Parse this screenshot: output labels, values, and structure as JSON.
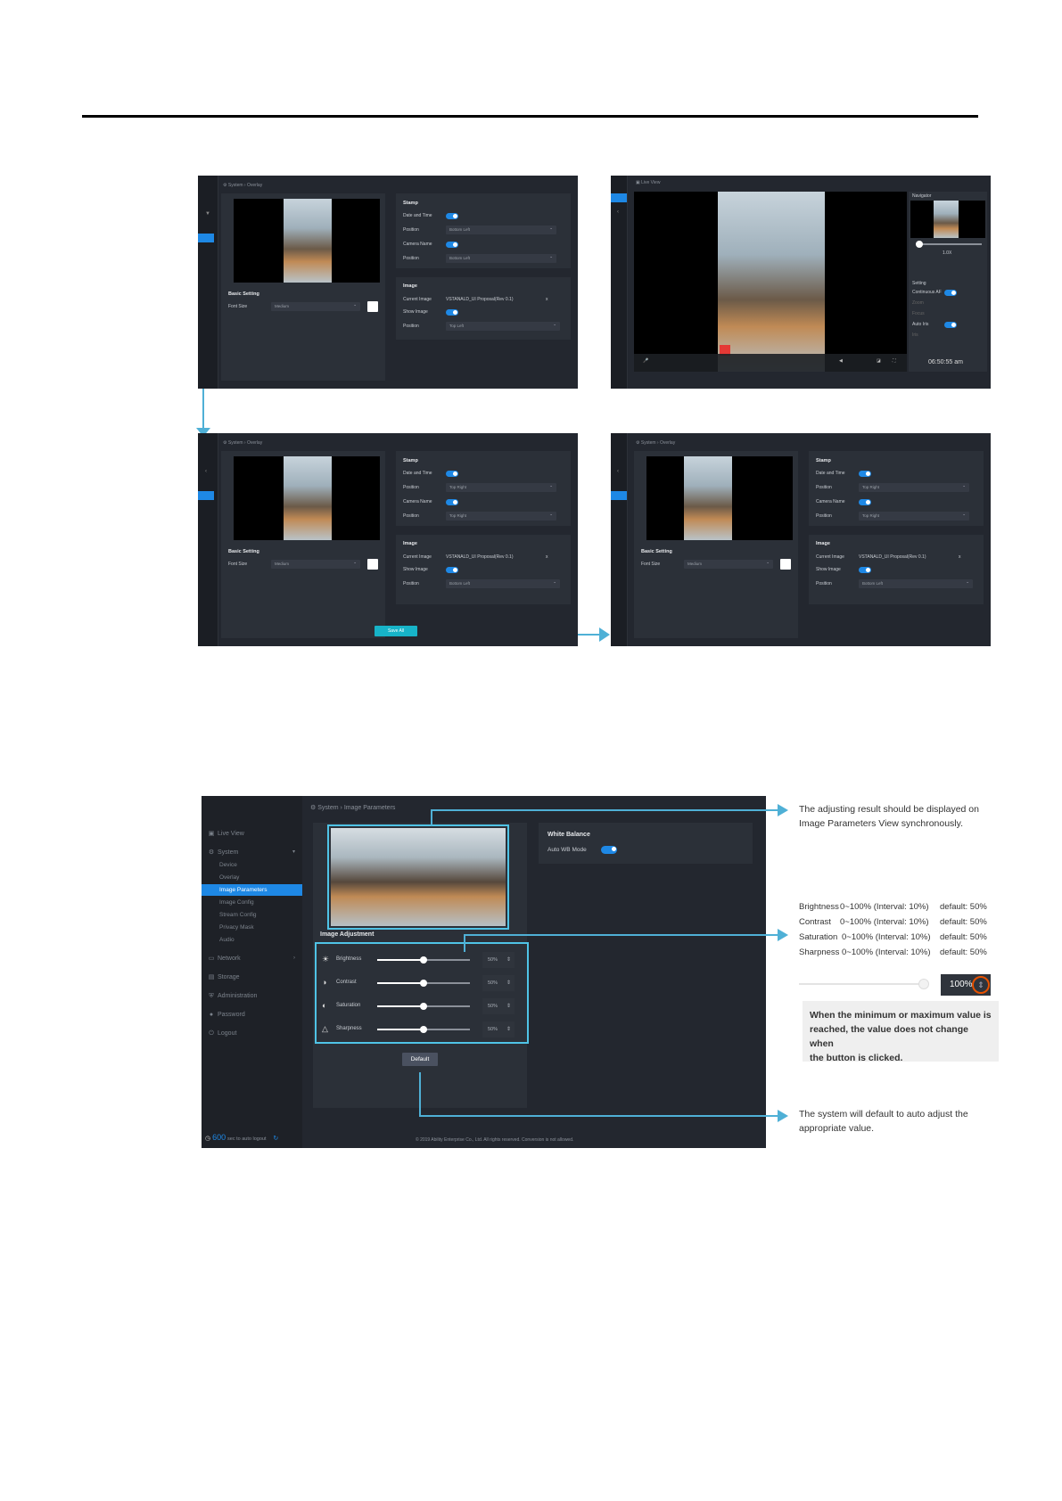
{
  "overlay_screens": {
    "breadcrumb": "System  ›  Overlay",
    "stamp": {
      "title": "Stamp",
      "date_time": "Date and Time",
      "position": "Position",
      "camera_name": "Camera Name"
    },
    "image": {
      "title": "Image",
      "current_image": "Current Image",
      "current_image_value": "VSTANALD_UI Proposal(Rev 0.1)",
      "current_image_close": "x",
      "show_image": "Show Image",
      "position": "Position"
    },
    "basic": {
      "title": "Basic Setting",
      "font_size": "Font Size",
      "font_size_value": "Medium"
    },
    "screen1": {
      "stamp_pos1": "Bottom Left",
      "stamp_pos2": "Bottom Left",
      "image_pos": "Top Left"
    },
    "screen3": {
      "stamp_pos1": "Top Right",
      "stamp_pos2": "Top Right",
      "image_pos": "Bottom Left",
      "save": "Save All"
    },
    "screen4": {
      "stamp_pos1": "Top Right",
      "stamp_pos2": "Top Right",
      "image_pos": "Bottom Left"
    }
  },
  "live_view": {
    "breadcrumb": "Live View",
    "navigator": "Navigator",
    "zoom": "1.0X",
    "setting": "Setting",
    "continuous_af": "Continuous AF",
    "zoom_label": "Zoom",
    "focus": "Focus",
    "auto_iris": "Auto Iris",
    "iris": "Iris",
    "time": "06:50:55",
    "time_suffix": "am"
  },
  "image_params": {
    "breadcrumb_system": "System",
    "breadcrumb_sep": "›",
    "breadcrumb_page": "Image Parameters",
    "sidebar": [
      {
        "label": "Live View",
        "icon": "video-icon"
      },
      {
        "label": "System",
        "icon": "gear-icon"
      },
      {
        "label": "Device",
        "sub": true
      },
      {
        "label": "Overlay",
        "sub": true
      },
      {
        "label": "Image Parameters",
        "sub": true,
        "active": true
      },
      {
        "label": "Image Config",
        "sub": true
      },
      {
        "label": "Stream Config",
        "sub": true
      },
      {
        "label": "Privacy Mask",
        "sub": true
      },
      {
        "label": "Audio",
        "sub": true
      },
      {
        "label": "Network",
        "icon": "network-icon"
      },
      {
        "label": "Storage",
        "icon": "storage-icon"
      },
      {
        "label": "Administration",
        "icon": "shield-icon"
      },
      {
        "label": "Password",
        "icon": "user-icon"
      },
      {
        "label": "Logout",
        "icon": "power-icon"
      }
    ],
    "timer_value": "600",
    "timer_text": "sec to auto logout",
    "adjust_title": "Image Adjustment",
    "adjust_rows": [
      {
        "label": "Brightness",
        "value": "50%",
        "level": 0.5
      },
      {
        "label": "Contrast",
        "value": "50%",
        "level": 0.5
      },
      {
        "label": "Saturation",
        "value": "50%",
        "level": 0.5
      },
      {
        "label": "Sharpness",
        "value": "50%",
        "level": 0.5
      }
    ],
    "default_button": "Default",
    "wb_title": "White Balance",
    "wb_mode": "Auto WB Mode",
    "footer": "© 2019 Ability Enterprise Co., Ltd. All rights reserved.    Conversion is not allowed."
  },
  "annotations": {
    "sync_line1": "The adjusting result should be displayed on",
    "sync_line2": "Image Parameters View synchronously.",
    "ranges": [
      {
        "name": "Brightness",
        "range": "0~100% (Interval: 10%)",
        "def": "default: 50%"
      },
      {
        "name": "Contrast",
        "range": "0~100% (Interval: 10%)",
        "def": "default: 50%"
      },
      {
        "name": "Saturation",
        "range": "0~100% (Interval: 10%)",
        "def": "default: 50%"
      },
      {
        "name": "Sharpness",
        "range": "0~100% (Interval: 10%)",
        "def": "default: 50%"
      }
    ],
    "max_value": "100%",
    "note_line1": "When the minimum or maximum value is",
    "note_line2": "reached, the value does not change when",
    "note_line3": "the button is clicked.",
    "default_line1": "The system will default to auto adjust the",
    "default_line2": "appropriate value."
  }
}
